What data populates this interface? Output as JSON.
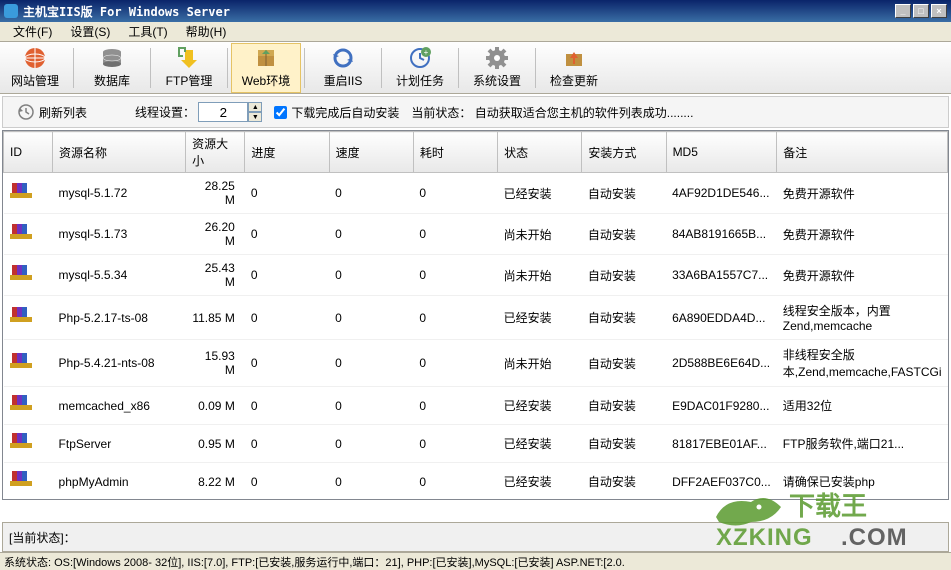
{
  "window": {
    "title": "主机宝IIS版  For Windows Server"
  },
  "menu": {
    "file": "文件(F)",
    "settings": "设置(S)",
    "tools": "工具(T)",
    "help": "帮助(H)"
  },
  "toolbar": {
    "site_mgmt": "网站管理",
    "database": "数据库",
    "ftp_mgmt": "FTP管理",
    "web_env": "Web环境",
    "restart_iis": "重启IIS",
    "cron": "计划任务",
    "sys_settings": "系统设置",
    "check_update": "检查更新"
  },
  "options": {
    "refresh_label": "刷新列表",
    "thread_label": "线程设置：",
    "thread_value": "2",
    "auto_install_label": "下载完成后自动安装",
    "status_label": "当前状态：",
    "status_text": "自动获取适合您主机的软件列表成功........"
  },
  "columns": {
    "id": "ID",
    "name": "资源名称",
    "size": "资源大小",
    "progress": "进度",
    "speed": "速度",
    "time": "耗时",
    "state": "状态",
    "install_mode": "安装方式",
    "md5": "MD5",
    "note": "备注"
  },
  "rows": [
    {
      "name": "mysql-5.1.72",
      "size": "28.25 M",
      "progress": "0",
      "speed": "0",
      "time": "0",
      "state": "已经安装",
      "mode": "自动安装",
      "md5": "4AF92D1DE546...",
      "note": "免费开源软件"
    },
    {
      "name": "mysql-5.1.73",
      "size": "26.20 M",
      "progress": "0",
      "speed": "0",
      "time": "0",
      "state": "尚未开始",
      "mode": "自动安装",
      "md5": "84AB8191665B...",
      "note": "免费开源软件"
    },
    {
      "name": "mysql-5.5.34",
      "size": "25.43 M",
      "progress": "0",
      "speed": "0",
      "time": "0",
      "state": "尚未开始",
      "mode": "自动安装",
      "md5": "33A6BA1557C7...",
      "note": "免费开源软件"
    },
    {
      "name": "Php-5.2.17-ts-08",
      "size": "11.85 M",
      "progress": "0",
      "speed": "0",
      "time": "0",
      "state": "已经安装",
      "mode": "自动安装",
      "md5": "6A890EDDA4D...",
      "note": "线程安全版本，内置Zend,memcache"
    },
    {
      "name": "Php-5.4.21-nts-08",
      "size": "15.93 M",
      "progress": "0",
      "speed": "0",
      "time": "0",
      "state": "尚未开始",
      "mode": "自动安装",
      "md5": "2D588BE6E64D...",
      "note": "非线程安全版本,Zend,memcache,FASTCGi"
    },
    {
      "name": "memcached_x86",
      "size": "0.09 M",
      "progress": "0",
      "speed": "0",
      "time": "0",
      "state": "已经安装",
      "mode": "自动安装",
      "md5": "E9DAC01F9280...",
      "note": "适用32位"
    },
    {
      "name": "FtpServer",
      "size": "0.95 M",
      "progress": "0",
      "speed": "0",
      "time": "0",
      "state": "已经安装",
      "mode": "自动安装",
      "md5": "81817EBE01AF...",
      "note": "FTP服务软件,端口21..."
    },
    {
      "name": "phpMyAdmin",
      "size": "8.22 M",
      "progress": "0",
      "speed": "0",
      "time": "0",
      "state": "已经安装",
      "mode": "自动安装",
      "md5": "DFF2AEF037C0...",
      "note": "请确保已安装php"
    }
  ],
  "status_area": "[当前状态]：",
  "bottom_status": "系统状态: OS:[Windows 2008- 32位], IIS:[7.0], FTP:[已安装,服务运行中,端口：21], PHP:[已安装],MySQL:[已安装] ASP.NET:[2.0.",
  "watermark": {
    "brand": "下载王",
    "domain": "XZKING",
    "dotcom": ".COM"
  }
}
